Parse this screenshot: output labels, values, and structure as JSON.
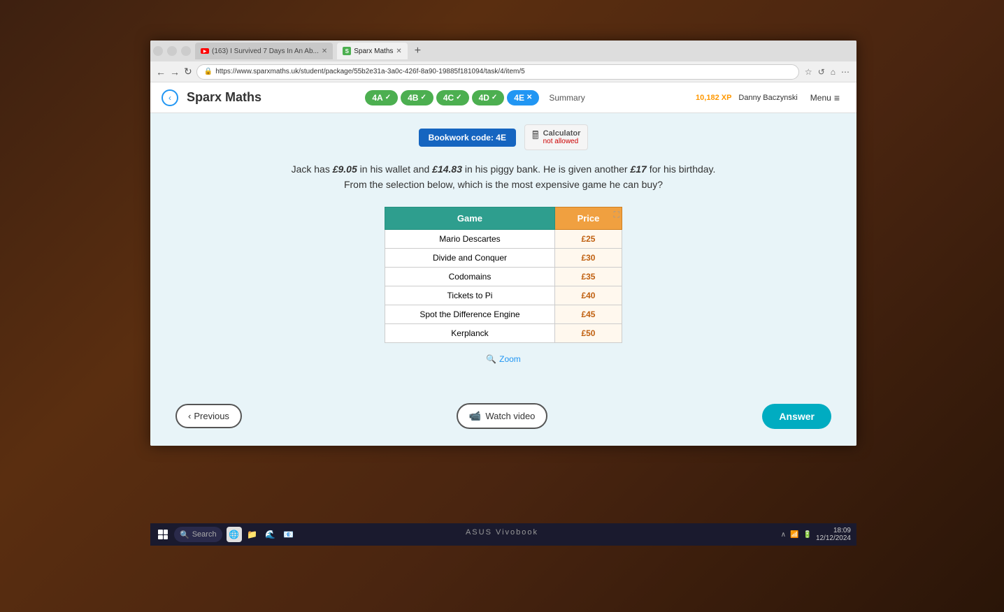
{
  "browser": {
    "tabs": [
      {
        "id": "yt",
        "label": "(163) I Survived 7 Days In An Ab...",
        "type": "youtube",
        "active": false
      },
      {
        "id": "sparx",
        "label": "Sparx Maths",
        "type": "sparx",
        "active": true
      }
    ],
    "address": "https://www.sparxmaths.uk/student/package/55b2e31a-3a0c-426f-8a90-19885f181094/task/4/item/5",
    "nav": {
      "back": "←",
      "forward": "→",
      "refresh": "↻"
    },
    "browser_actions": [
      "★",
      "↺",
      "☆",
      "⋯"
    ]
  },
  "sparx": {
    "title": "Sparx Maths",
    "back_label": "‹",
    "tabs": [
      {
        "id": "4A",
        "label": "4A",
        "state": "complete"
      },
      {
        "id": "4B",
        "label": "4B",
        "state": "complete"
      },
      {
        "id": "4C",
        "label": "4C",
        "state": "complete"
      },
      {
        "id": "4D",
        "label": "4D",
        "state": "complete"
      },
      {
        "id": "4E",
        "label": "4E",
        "state": "current"
      },
      {
        "id": "summary",
        "label": "Summary",
        "state": "summary"
      }
    ],
    "user": {
      "xp": "10,182 XP",
      "name": "Danny Baczynski",
      "menu_label": "Menu"
    },
    "bookwork_code": "Bookwork code: 4E",
    "calculator_label": "Calculator",
    "calculator_status": "not allowed",
    "question": {
      "line1": "Jack has £9.05 in his wallet and £14.83 in his piggy bank. He is given another £17 for his birthday.",
      "line2": "From the selection below, which is the most expensive game he can buy?"
    },
    "table": {
      "headers": [
        "Game",
        "Price"
      ],
      "rows": [
        {
          "game": "Mario Descartes",
          "price": "£25"
        },
        {
          "game": "Divide and Conquer",
          "price": "£30"
        },
        {
          "game": "Codomains",
          "price": "£35"
        },
        {
          "game": "Tickets to Pi",
          "price": "£40"
        },
        {
          "game": "Spot the Difference Engine",
          "price": "£45"
        },
        {
          "game": "Kerplanck",
          "price": "£50"
        }
      ]
    },
    "zoom_label": "Zoom",
    "buttons": {
      "previous": "< Previous",
      "watch_video": "Watch video",
      "answer": "Answer"
    }
  },
  "taskbar": {
    "search_placeholder": "Search",
    "time": "18:09",
    "date": "12/12/2024"
  },
  "laptop": {
    "brand": "ASUS Vivobook"
  }
}
